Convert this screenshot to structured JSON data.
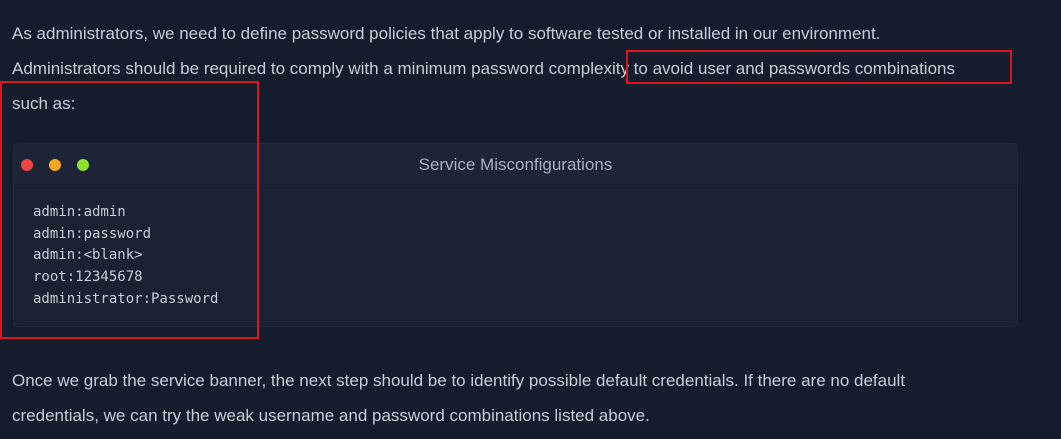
{
  "intro": {
    "lines": [
      "As administrators, we need to define password policies that apply to software tested or installed in our environment.",
      "Administrators should be required to comply with a minimum password complexity to avoid user and passwords combinations",
      "such as:"
    ]
  },
  "terminal": {
    "title": "Service Misconfigurations",
    "window_dots": [
      "#ef4444",
      "#f5a623",
      "#8be32d"
    ],
    "lines": [
      "admin:admin",
      "admin:password",
      "admin:<blank>",
      "root:12345678",
      "administrator:Password"
    ]
  },
  "outro": {
    "lines": [
      "Once we grab the service banner, the next step should be to identify possible default credentials. If there are no default",
      "credentials, we can try the weak username and password combinations listed above."
    ]
  },
  "annotations": {
    "highlight_color": "#e0121d"
  }
}
